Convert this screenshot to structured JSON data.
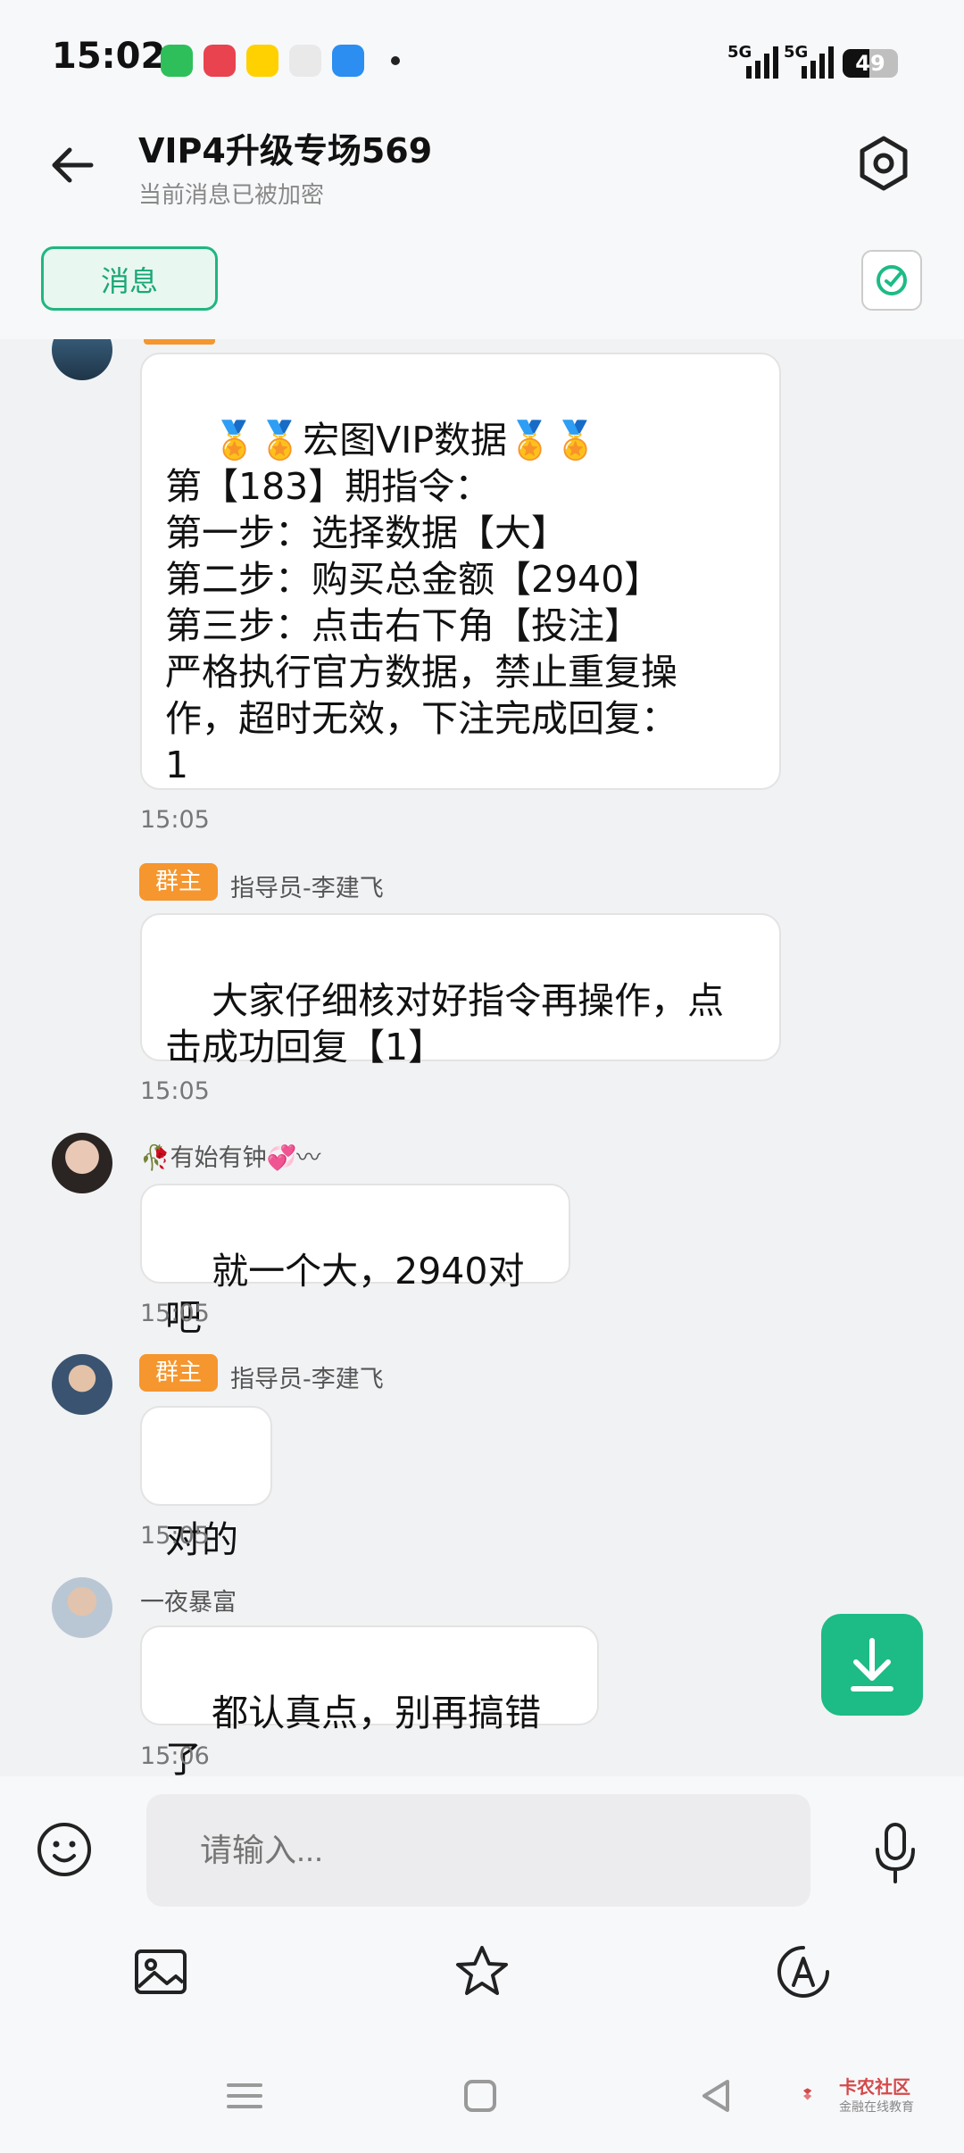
{
  "status_bar": {
    "time": "15:02",
    "app_icons": [
      "iqiyi-icon",
      "video-icon",
      "meituan-icon",
      "oppo-icon",
      "browser-icon"
    ],
    "network_1": "5G",
    "network_2": "5G",
    "battery": "49",
    "battery_level": 0.49
  },
  "header": {
    "title": "VIP4升级专场569",
    "subtitle": "当前消息已被加密",
    "tab_label": "消息"
  },
  "messages": [
    {
      "text": "🏅🏅宏图VIP数据🏅🏅\n第【183】期指令：\n第一步：选择数据【大】\n第二步：购买总金额【2940】\n第三步：点击右下角【投注】\n严格执行官方数据，禁止重复操\n作，超时无效，下注完成回复：\n1",
      "time": "15:05"
    },
    {
      "badge": "群主",
      "sender": "指导员-李建飞",
      "text": "大家仔细核对好指令再操作，点\n击成功回复【1】",
      "time": "15:05"
    },
    {
      "sender": "🥀有始有钟💞〰",
      "text": "就一个大，2940对吧",
      "time": "15:05"
    },
    {
      "badge": "群主",
      "sender": "指导员-李建飞",
      "text": "对的",
      "time": "15:05"
    },
    {
      "sender": "一夜暴富",
      "text": "都认真点，别再搞错了",
      "time": "15:06"
    }
  ],
  "input": {
    "placeholder": "请输入..."
  },
  "watermark": {
    "name": "卡农社区",
    "sub": "金融在线教育"
  },
  "colors": {
    "accent": "#1dbb86",
    "badge": "#f5962e"
  }
}
